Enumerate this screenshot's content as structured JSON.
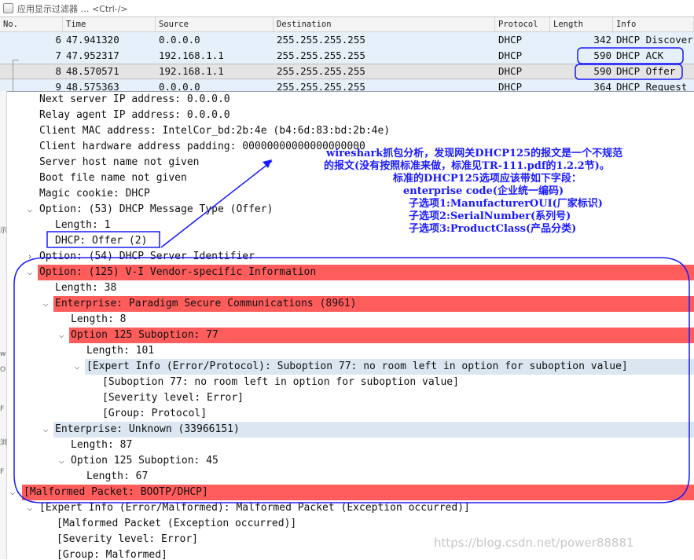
{
  "filter": {
    "text": "应用显示过滤器 … <Ctrl-/>"
  },
  "packet_list": {
    "columns": [
      "No.",
      "Time",
      "Source",
      "Destination",
      "Protocol",
      "Length",
      "Info"
    ],
    "rows": [
      {
        "no": "6",
        "time": "47.941320",
        "source": "0.0.0.0",
        "destination": "255.255.255.255",
        "protocol": "DHCP",
        "length": "342",
        "info": "DHCP Discover"
      },
      {
        "no": "7",
        "time": "47.952317",
        "source": "192.168.1.1",
        "destination": "255.255.255.255",
        "protocol": "DHCP",
        "length": "590",
        "info": "DHCP ACK"
      },
      {
        "no": "8",
        "time": "48.570571",
        "source": "192.168.1.1",
        "destination": "255.255.255.255",
        "protocol": "DHCP",
        "length": "590",
        "info": "DHCP Offer"
      },
      {
        "no": "9",
        "time": "48.575363",
        "source": "0.0.0.0",
        "destination": "255.255.255.255",
        "protocol": "DHCP",
        "length": "364",
        "info": "DHCP Request"
      }
    ]
  },
  "details": [
    {
      "text": "Next server IP address: 0.0.0.0"
    },
    {
      "text": "Relay agent IP address: 0.0.0.0"
    },
    {
      "text": "Client MAC address: IntelCor_bd:2b:4e (b4:6d:83:bd:2b:4e)"
    },
    {
      "text": "Client hardware address padding: 00000000000000000000"
    },
    {
      "text": "Server host name not given"
    },
    {
      "text": "Boot file name not given"
    },
    {
      "text": "Magic cookie: DHCP"
    },
    {
      "text": "Option: (53) DHCP Message Type (Offer)"
    },
    {
      "text": "Length: 1"
    },
    {
      "text": "DHCP: Offer (2)"
    },
    {
      "text": "Option: (54) DHCP Server Identifier"
    },
    {
      "text": "Option: (125) V-I Vendor-specific Information"
    },
    {
      "text": "Length: 38"
    },
    {
      "text": "Enterprise: Paradigm Secure Communications (8961)"
    },
    {
      "text": "Length: 8"
    },
    {
      "text": "Option 125 Suboption: 77"
    },
    {
      "text": "Length: 101"
    },
    {
      "text": "[Expert Info (Error/Protocol): Suboption 77: no room left in option for suboption value]"
    },
    {
      "text": "[Suboption 77: no room left in option for suboption value]"
    },
    {
      "text": "[Severity level: Error]"
    },
    {
      "text": "[Group: Protocol]"
    },
    {
      "text": "Enterprise: Unknown (33966151)"
    },
    {
      "text": "Length: 87"
    },
    {
      "text": "Option 125 Suboption: 45"
    },
    {
      "text": "Length: 67"
    },
    {
      "text": "[Malformed Packet: BOOTP/DHCP]"
    },
    {
      "text": "[Expert Info (Error/Malformed): Malformed Packet (Exception occurred)]"
    },
    {
      "text": "[Malformed Packet (Exception occurred)]"
    },
    {
      "text": "[Severity level: Error]"
    },
    {
      "text": "[Group: Malformed]"
    }
  ],
  "annotation": {
    "lines": [
      "wireshark抓包分析，发现网关DHCP125的报文是一个不规范",
      "的报文(没有按照标准来做，标准见TR-111.pdf的1.2.2节)。",
      "标准的DHCP125选项应该带如下字段：",
      "enterprise code(企业统一编码)",
      "子选项1:ManufacturerOUI(厂家标识)",
      "子选项2:SerialNumber(系列号)",
      "子选项3:ProductClass(产品分类)"
    ]
  },
  "watermark": "https://blog.csdn.net/power88881",
  "colors": {
    "error_red": "#ff5c5c",
    "annotation_blue": "#1a1aff",
    "selected_row": "#dbe6f1",
    "list_row": "#e6f0fa"
  }
}
